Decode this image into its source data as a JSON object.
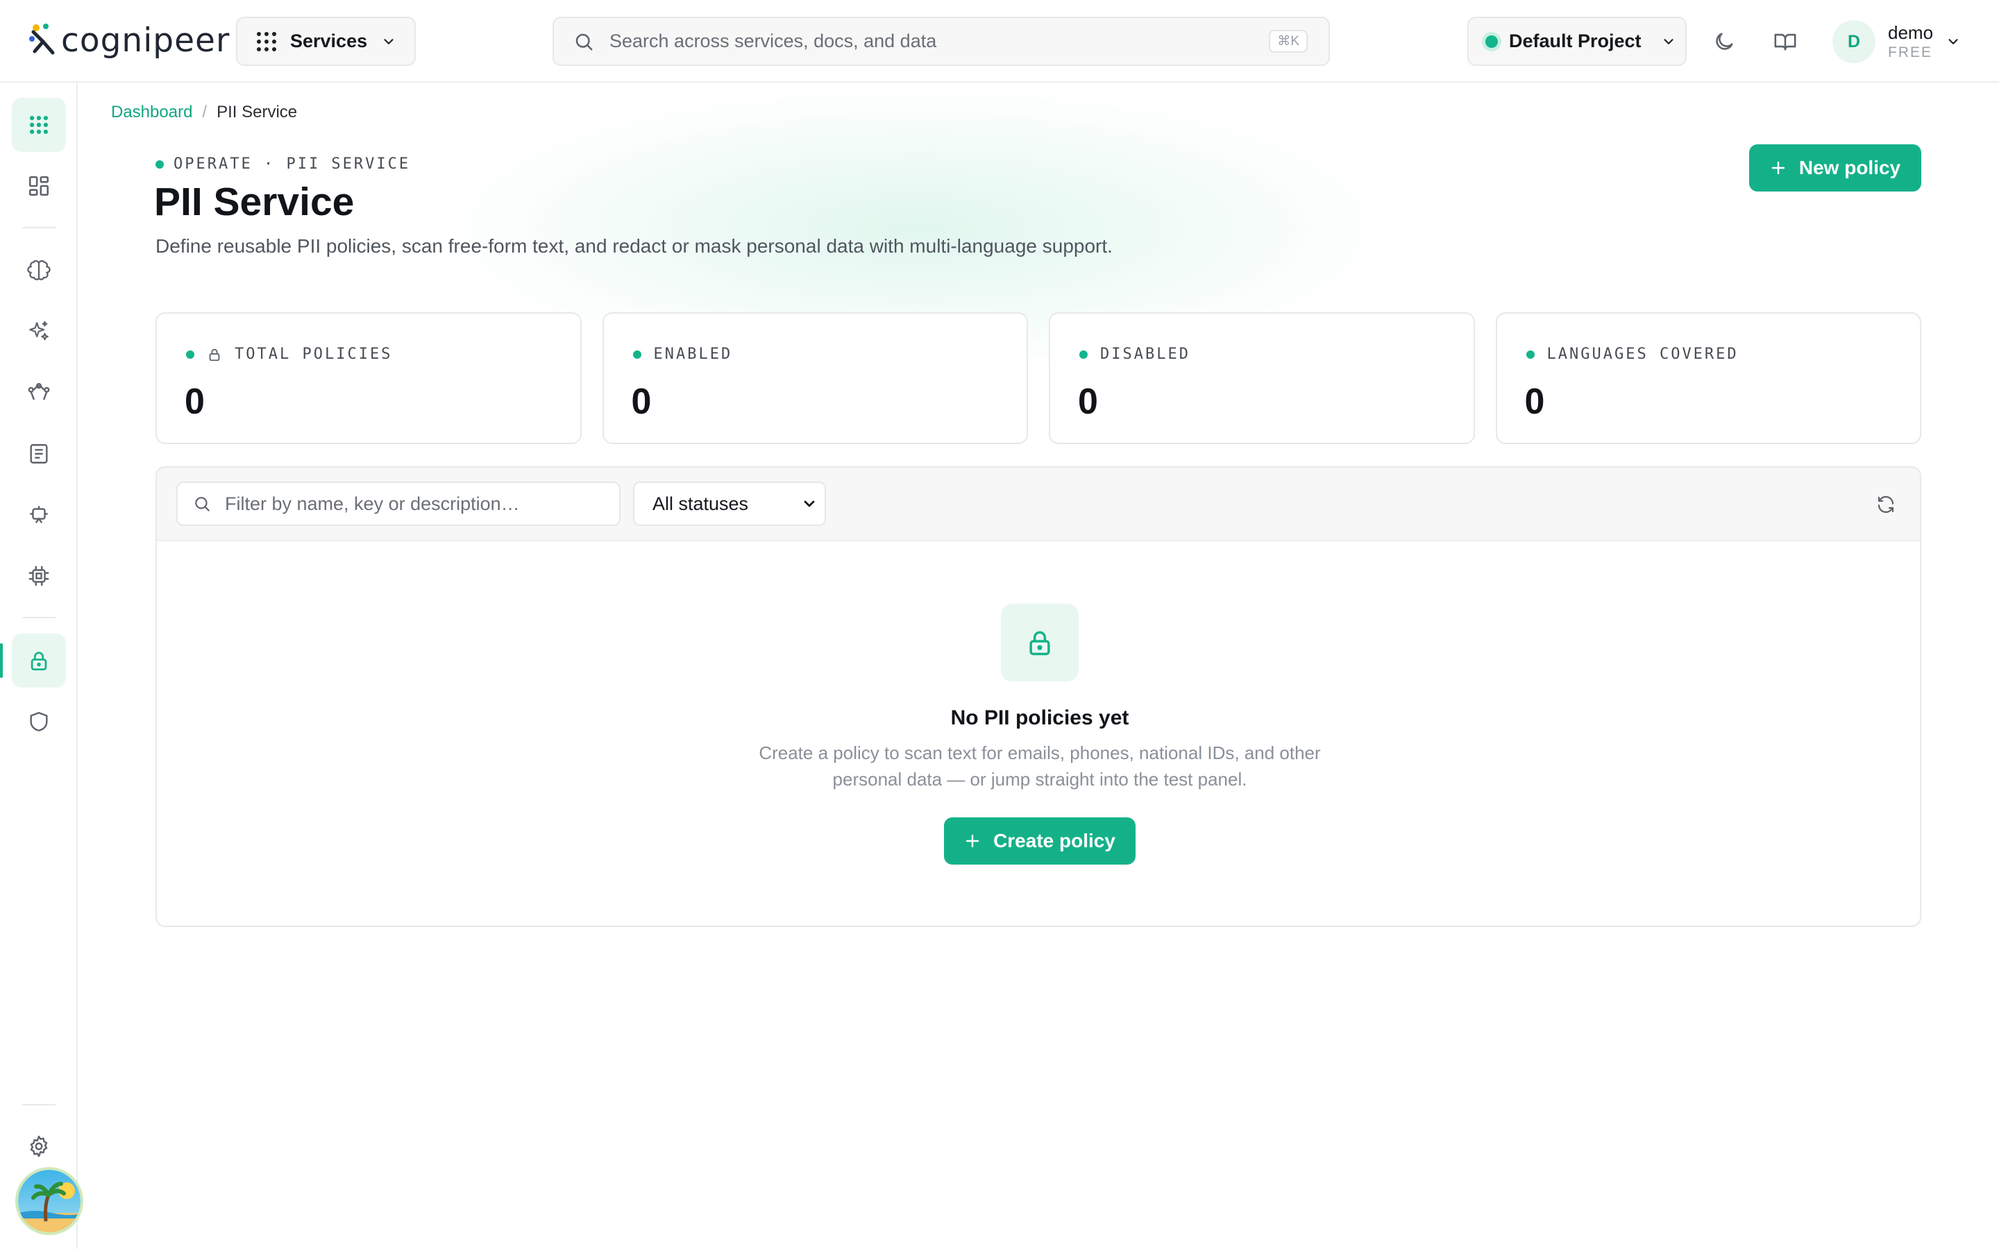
{
  "brand": {
    "name": "cognipeer",
    "accent": "#14b189"
  },
  "header": {
    "services_label": "Services",
    "search_placeholder": "Search across services, docs, and data",
    "search_shortcut": "⌘K",
    "project_label": "Default Project",
    "user": {
      "initial": "D",
      "name": "demo",
      "plan": "FREE"
    }
  },
  "sidebar": {
    "items": [
      {
        "name": "services-grid",
        "icon": "grid-dots-icon",
        "active": true
      },
      {
        "name": "dashboard",
        "icon": "layout-icon"
      },
      {
        "name": "ai-models",
        "icon": "brain-icon"
      },
      {
        "name": "ai-tools",
        "icon": "sparkles-icon"
      },
      {
        "name": "workflows",
        "icon": "route-icon"
      },
      {
        "name": "docs",
        "icon": "file-text-icon"
      },
      {
        "name": "agents",
        "icon": "robot-icon"
      },
      {
        "name": "compute",
        "icon": "cpu-icon"
      },
      {
        "name": "pii-service",
        "icon": "lock-icon",
        "active": true
      },
      {
        "name": "security",
        "icon": "shield-icon"
      },
      {
        "name": "settings",
        "icon": "gear-icon"
      }
    ]
  },
  "breadcrumb": {
    "root": "Dashboard",
    "separator": "/",
    "current": "PII Service"
  },
  "page": {
    "eyebrow": "OPERATE · PII SERVICE",
    "title": "PII Service",
    "description": "Define reusable PII policies, scan free-form text, and redact or mask personal data with multi-language support.",
    "new_policy_label": "New policy"
  },
  "stats": [
    {
      "label": "TOTAL POLICIES",
      "value": "0",
      "icon": "lock-icon"
    },
    {
      "label": "ENABLED",
      "value": "0"
    },
    {
      "label": "DISABLED",
      "value": "0"
    },
    {
      "label": "LANGUAGES COVERED",
      "value": "0"
    }
  ],
  "filters": {
    "search_placeholder": "Filter by name, key or description…",
    "status_selected": "All statuses"
  },
  "empty": {
    "title": "No PII policies yet",
    "description": "Create a policy to scan text for emails, phones, national IDs, and other personal data — or jump straight into the test panel.",
    "create_label": "Create policy"
  }
}
